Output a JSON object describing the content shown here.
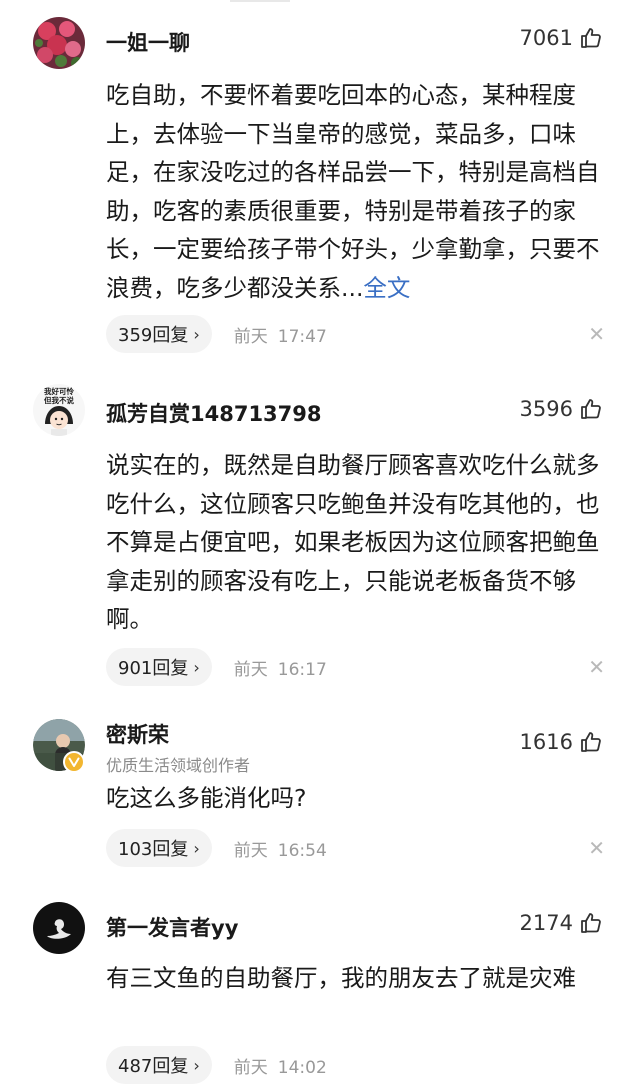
{
  "comments": [
    {
      "username": "一姐一聊",
      "likes": "7061",
      "text": "吃自助，不要怀着要吃回本的心态，某种程度上，去体验一下当皇帝的感觉，菜品多，口味足，在家没吃过的各样品尝一下，特别是高档自助，吃客的素质很重要，特别是带着孩子的家长，一定要给孩子带个好头，少拿勤拿，只要不浪费，吃多少都没关系...",
      "fulltext_label": "全文",
      "replies": "359回复",
      "day": "前天",
      "time": "17:47"
    },
    {
      "username": "孤芳自赏148713798",
      "avatar_text": [
        "我好可怜",
        "但我不说"
      ],
      "likes": "3596",
      "text": "说实在的，既然是自助餐厅顾客喜欢吃什么就多吃什么，这位顾客只吃鲍鱼并没有吃其他的，也不算是占便宜吧，如果老板因为这位顾客把鲍鱼拿走别的顾客没有吃上，只能说老板备货不够啊。",
      "replies": "901回复",
      "day": "前天",
      "time": "16:17"
    },
    {
      "username": "密斯荣",
      "subtitle": "优质生活领域创作者",
      "likes": "1616",
      "text": "吃这么多能消化吗?",
      "replies": "103回复",
      "day": "前天",
      "time": "16:54"
    },
    {
      "username": "第一发言者yy",
      "likes": "2174",
      "text": "有三文鱼的自助餐厅，我的朋友去了就是灾难",
      "replies": "487回复",
      "day": "前天",
      "time": "14:02"
    }
  ],
  "colors": {
    "link": "#3a6fc4",
    "muted": "#999999",
    "pill_bg": "#f3f3f3",
    "verified": "#f2b630"
  },
  "icons": {
    "like": "thumbs-up-icon",
    "chevron": "chevron-right-icon",
    "close": "close-icon",
    "verified": "verified-badge-icon"
  },
  "glyphs": {
    "chevron": "›",
    "close": "✕"
  }
}
